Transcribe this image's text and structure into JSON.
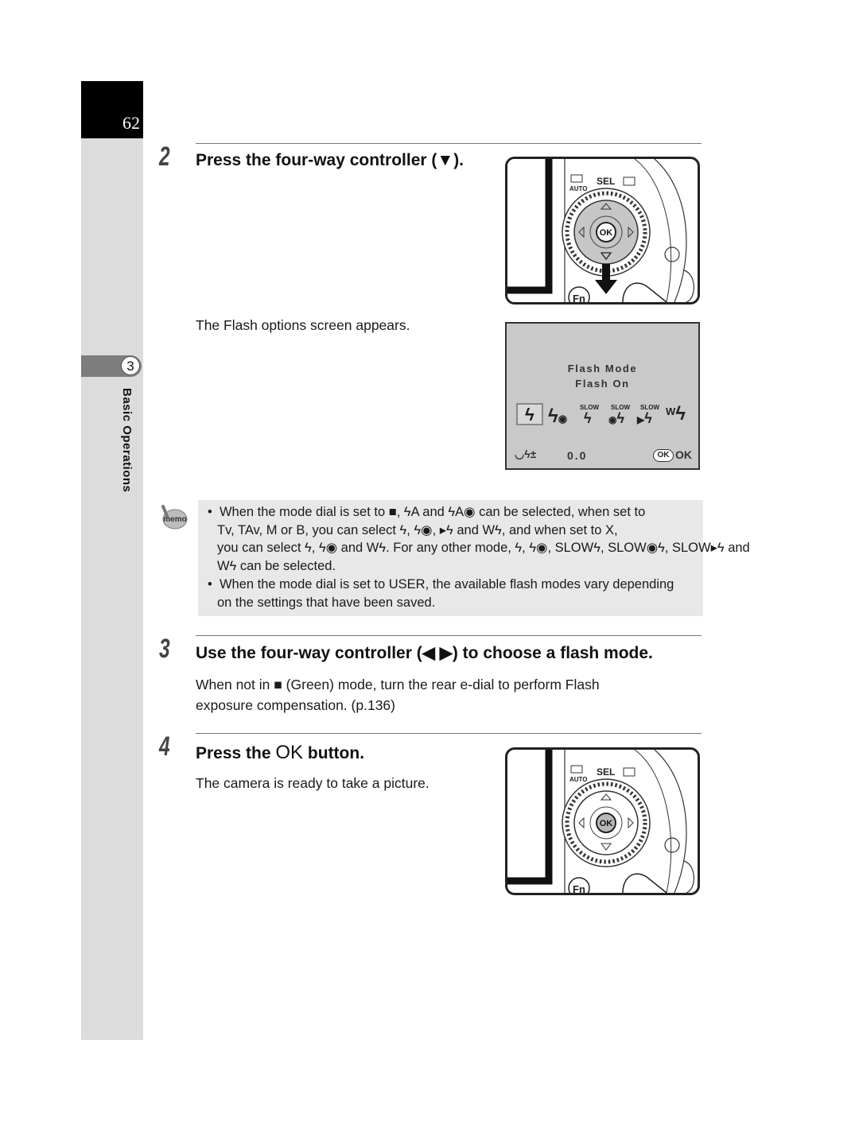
{
  "page": {
    "number": "62"
  },
  "sidebar": {
    "chapter_number": "3",
    "chapter_title": "Basic Operations"
  },
  "steps": [
    {
      "number": "2",
      "title": "Press the four-way controller (▼).",
      "body": "The Flash options screen appears."
    },
    {
      "number": "3",
      "title": "Use the four-way controller (◀ ▶) to choose a flash mode.",
      "body_line1": "When not in ■ (Green) mode, turn the rear e-dial to perform Flash",
      "body_line2": "exposure compensation. (p.136)"
    },
    {
      "number": "4",
      "title_prefix": "Press the ",
      "title_ok": "OK",
      "title_suffix": " button.",
      "body": "The camera is ready to take a picture."
    }
  ],
  "camera_illustration": {
    "labels": {
      "auto": "AUTO",
      "sel": "SEL",
      "ok": "OK",
      "fn": "Fn"
    }
  },
  "lcd_screen": {
    "heading": "Flash Mode",
    "selected_mode": "Flash On",
    "modes": [
      {
        "icon": "flash-on-icon",
        "glyph": "ϟ",
        "selected": true
      },
      {
        "icon": "flash-redeye-icon",
        "glyph": "ϟ◉",
        "selected": false
      },
      {
        "icon": "slow-sync-icon",
        "label": "SLOW",
        "selected": false
      },
      {
        "icon": "slow-sync-redeye-icon",
        "label": "SLOW",
        "selected": false
      },
      {
        "icon": "trailing-curtain-sync-icon",
        "label": "SLOW",
        "selected": false
      },
      {
        "icon": "wireless-flash-icon",
        "label": "W",
        "selected": false
      }
    ],
    "exposure_comp_label": "0.0",
    "ok_button": "OK",
    "ok_label": "OK"
  },
  "memo": {
    "icon_label": "memo",
    "bullets": [
      {
        "lines": [
          "When the mode dial is set to ■, ϟA and ϟA◉ can be selected, when set to",
          "Tv, TAv, M or B, you can select ϟ, ϟ◉, ▸ϟ and Wϟ, and when set to X,",
          "you can select ϟ, ϟ◉ and Wϟ. For any other mode, ϟ, ϟ◉, SLOWϟ, SLOW◉ϟ, SLOW▸ϟ and",
          "Wϟ can be selected."
        ]
      },
      {
        "lines": [
          "When the mode dial is set to USER, the available flash modes vary depending",
          "on the settings that have been saved."
        ]
      }
    ]
  }
}
